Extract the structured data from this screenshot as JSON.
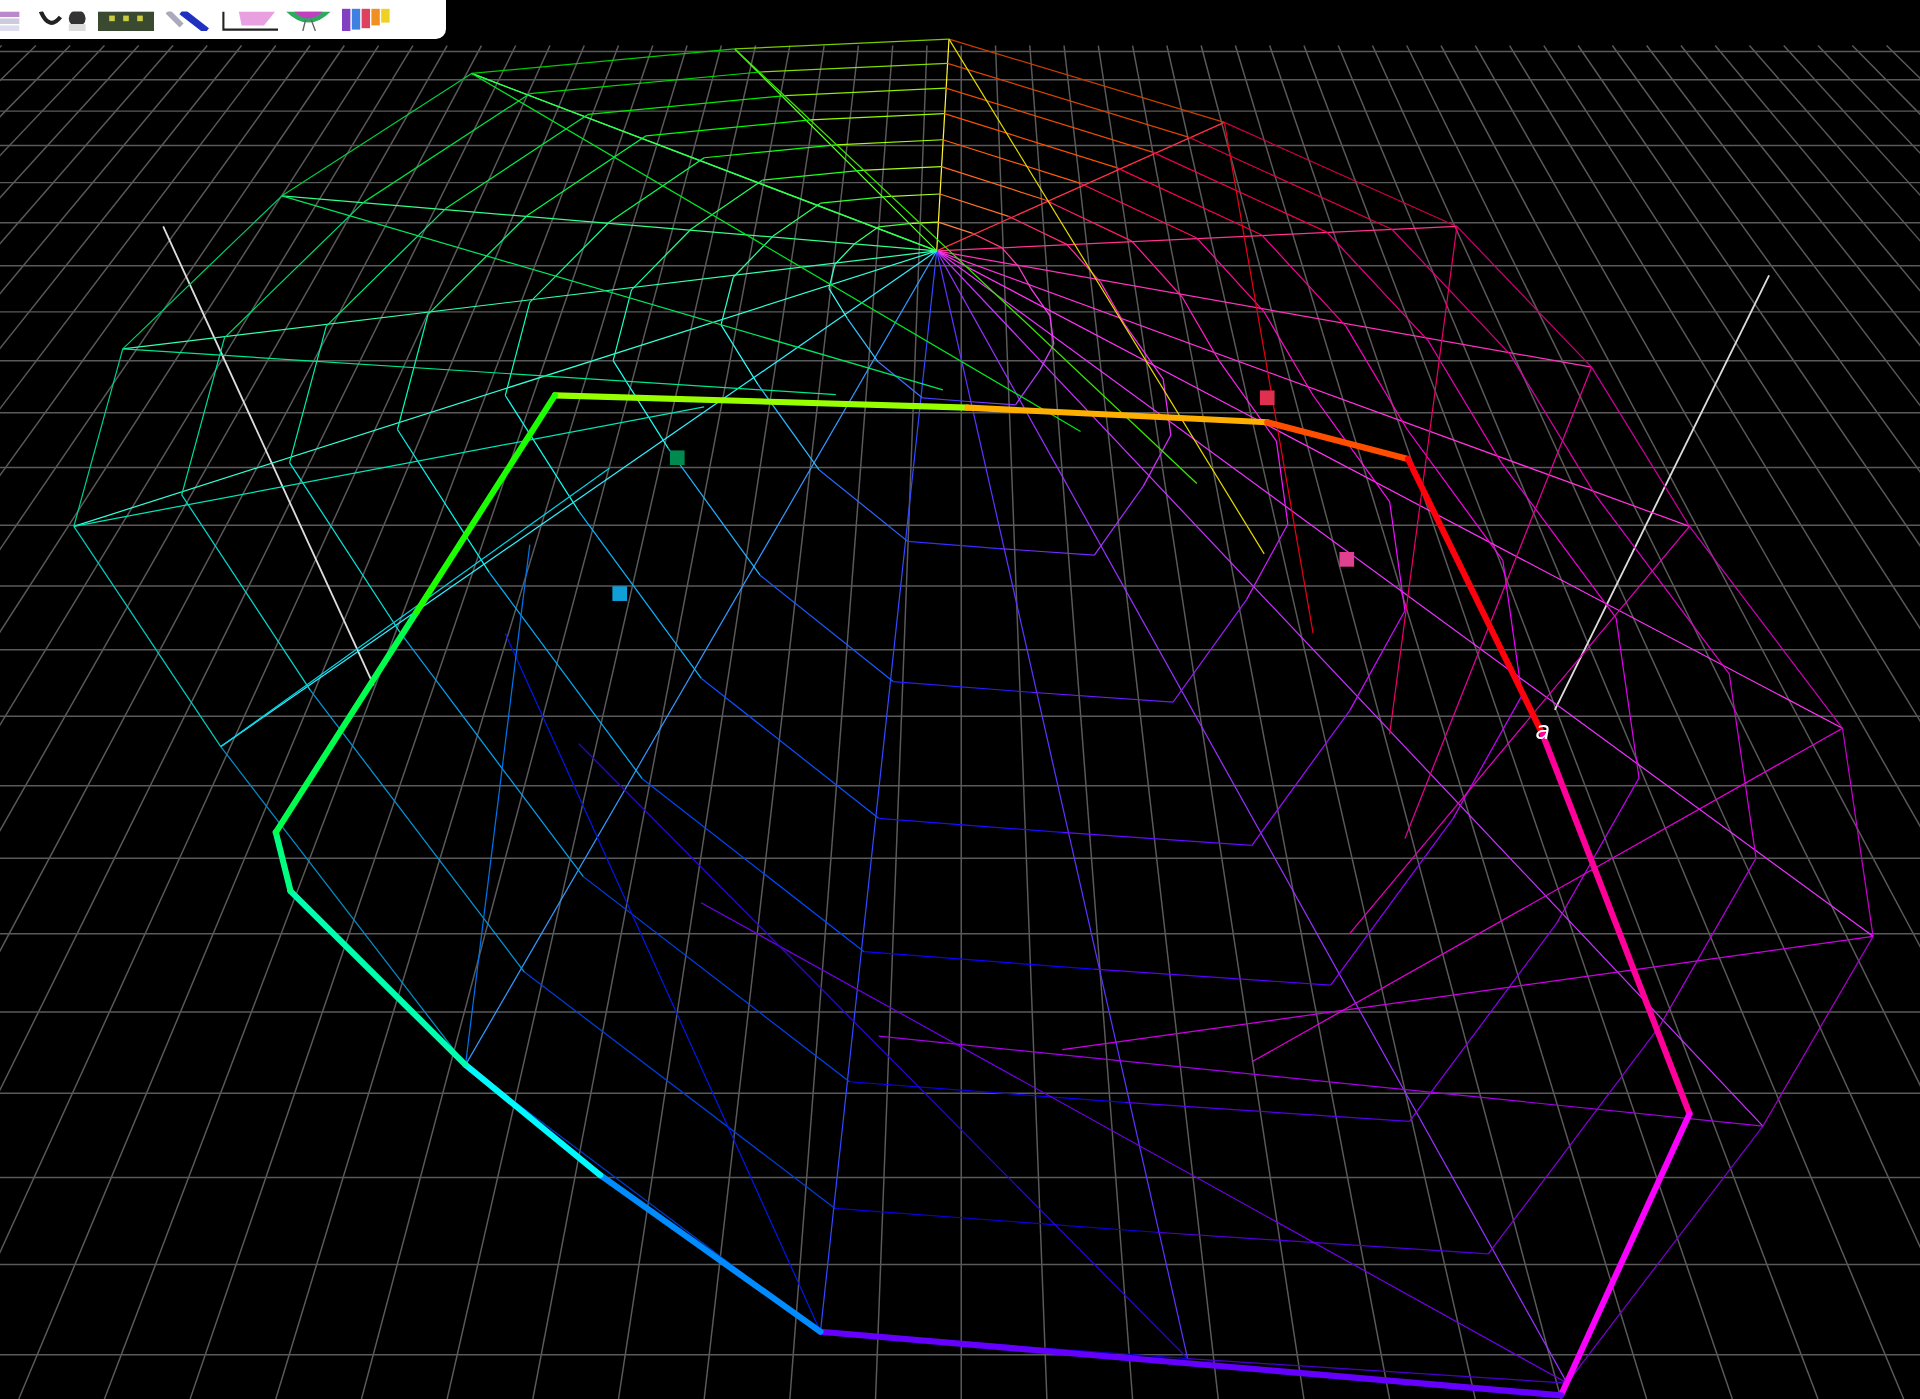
{
  "viewer": {
    "axis_label": "a",
    "markers": [
      {
        "color": "#008a50"
      },
      {
        "color": "#10a0d8"
      },
      {
        "color": "#e03050"
      },
      {
        "color": "#e04090"
      }
    ]
  }
}
